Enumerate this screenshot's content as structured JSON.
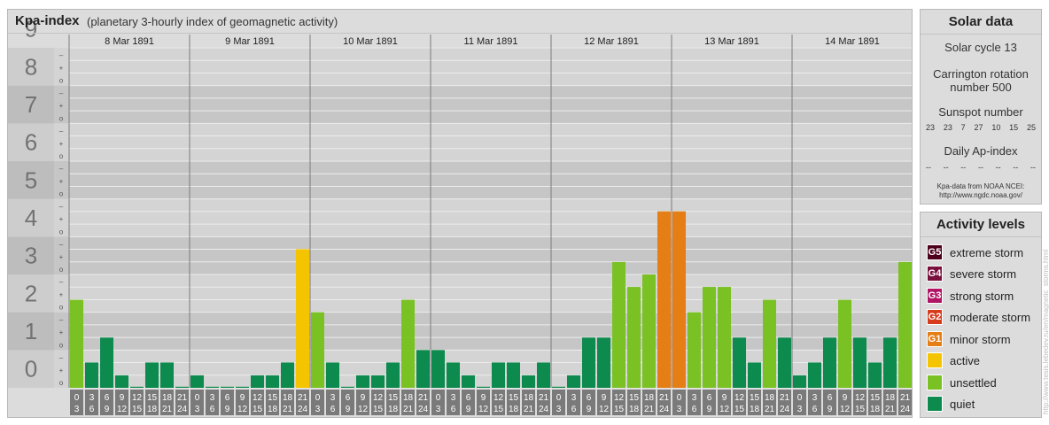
{
  "header": {
    "title": "Kpa-index",
    "subtitle": "(planetary 3-hourly index of geomagnetic activity)"
  },
  "chart_data": {
    "type": "bar",
    "title": "Kpa-index",
    "subtitle": "(planetary 3-hourly index of geomagnetic activity)",
    "ylim": [
      0,
      9
    ],
    "y_ticks": [
      "0",
      "1",
      "2",
      "3",
      "4",
      "5",
      "6",
      "7",
      "8",
      "9"
    ],
    "sub_ticks": [
      "o",
      "+",
      "–"
    ],
    "days": [
      "8 Mar 1891",
      "9 Mar 1891",
      "10 Mar 1891",
      "11 Mar 1891",
      "12 Mar 1891",
      "13 Mar 1891",
      "14 Mar 1891"
    ],
    "slots": [
      [
        "0",
        "3"
      ],
      [
        "3",
        "6"
      ],
      [
        "6",
        "9"
      ],
      [
        "9",
        "12"
      ],
      [
        "12",
        "15"
      ],
      [
        "15",
        "18"
      ],
      [
        "18",
        "21"
      ],
      [
        "21",
        "24"
      ]
    ],
    "values": [
      [
        2.33,
        0.67,
        1.33,
        0.33,
        0,
        0.67,
        0.67,
        0
      ],
      [
        0.33,
        0,
        0,
        0,
        0.33,
        0.33,
        0.67,
        3.67
      ],
      [
        2.0,
        0.67,
        0,
        0.33,
        0.33,
        0.67,
        2.33,
        1.0
      ],
      [
        1.0,
        0.67,
        0.33,
        0,
        0.67,
        0.67,
        0.33,
        0.67
      ],
      [
        0,
        0.33,
        1.33,
        1.33,
        3.33,
        2.67,
        3.0,
        4.67
      ],
      [
        4.67,
        2.0,
        2.67,
        2.67,
        1.33,
        0.67,
        2.33,
        1.33
      ],
      [
        0.33,
        0.67,
        1.33,
        2.33,
        1.33,
        0.67,
        1.33,
        3.33
      ]
    ],
    "grid": true,
    "legend": "right"
  },
  "solar": {
    "heading": "Solar data",
    "cycle": "Solar cycle 13",
    "carrington_line1": "Carrington rotation",
    "carrington_line2": "number 500",
    "sunspot_heading": "Sunspot number",
    "sunspot_values": [
      "23",
      "23",
      "7",
      "27",
      "10",
      "15",
      "25"
    ],
    "ap_heading": "Daily Ap-index",
    "ap_values": [
      "--",
      "--",
      "--",
      "--",
      "--",
      "--",
      "--"
    ],
    "credit_line1": "Kpa-data from NOAA NCEI:",
    "credit_line2": "http://www.ngdc.noaa.gov/"
  },
  "levels": {
    "heading": "Activity levels",
    "items": [
      {
        "badge": "G5",
        "label": "extreme storm",
        "color": "#4d0019"
      },
      {
        "badge": "G4",
        "label": "severe storm",
        "color": "#7a0f3d"
      },
      {
        "badge": "G3",
        "label": "strong storm",
        "color": "#b01463"
      },
      {
        "badge": "G2",
        "label": "moderate storm",
        "color": "#d83a1c"
      },
      {
        "badge": "G1",
        "label": "minor storm",
        "color": "#e67e16"
      },
      {
        "badge": "",
        "label": "active",
        "color": "#f5c400"
      },
      {
        "badge": "",
        "label": "unsettled",
        "color": "#7ac124"
      },
      {
        "badge": "",
        "label": "quiet",
        "color": "#0d8a4e"
      }
    ]
  },
  "watermark": "http://www.tesis.lebedev.ru/en/magnetic_storms.html"
}
